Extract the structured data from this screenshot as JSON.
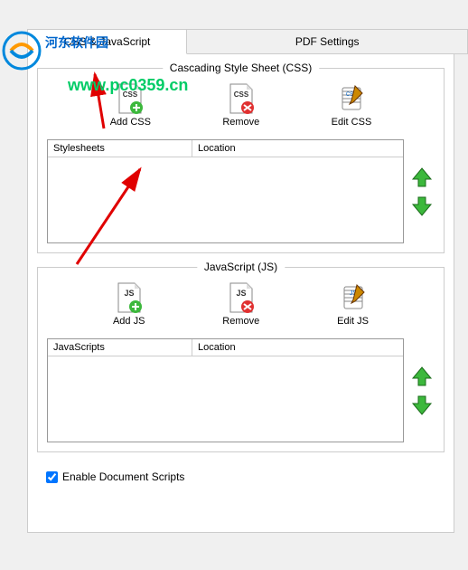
{
  "watermark": {
    "site_name": "河东软件园",
    "url": "www.pc0359.cn"
  },
  "tabs": {
    "css_js": "CSS & JavaScript",
    "pdf_settings": "PDF Settings"
  },
  "css_group": {
    "title": "Cascading Style Sheet (CSS)",
    "add_label": "Add CSS",
    "remove_label": "Remove",
    "edit_label": "Edit CSS",
    "col1": "Stylesheets",
    "col2": "Location",
    "icon_text": "CSS"
  },
  "js_group": {
    "title": "JavaScript (JS)",
    "add_label": "Add JS",
    "remove_label": "Remove",
    "edit_label": "Edit JS",
    "col1": "JavaScripts",
    "col2": "Location",
    "icon_text": "JS"
  },
  "enable_scripts": "Enable Document Scripts"
}
